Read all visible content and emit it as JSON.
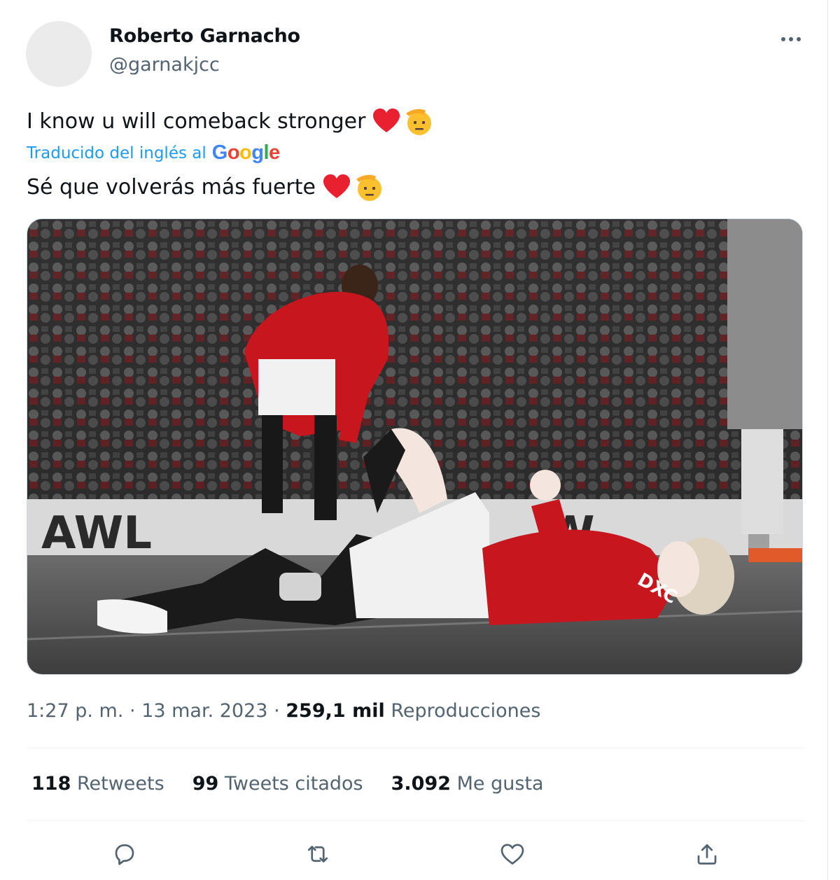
{
  "author": {
    "name": "Roberto Garnacho",
    "handle": "@garnakjcc"
  },
  "tweet": {
    "text": "I know u will comeback stronger",
    "translated_label": "Traducido del inglés al",
    "translation_provider": "Google",
    "translation": "Sé que volverás más fuerte",
    "emojis": [
      "red-heart-icon",
      "saluting-face-icon"
    ]
  },
  "meta": {
    "time": "1:27 p. m.",
    "separator": "·",
    "date": "13 mar. 2023",
    "views_count": "259,1 mil",
    "views_label": "Reproducciones"
  },
  "stats": {
    "retweets_count": "118",
    "retweets_label": "Retweets",
    "quotes_count": "99",
    "quotes_label": "Tweets citados",
    "likes_count": "3.092",
    "likes_label": "Me gusta"
  },
  "colors": {
    "link": "#1d9bf0",
    "secondary": "#536471",
    "primary": "#0f1419",
    "heart": "#e8202f",
    "google_blue": "#4285F4",
    "google_red": "#EA4335",
    "google_yellow": "#FBBC05",
    "google_green": "#34A853"
  }
}
